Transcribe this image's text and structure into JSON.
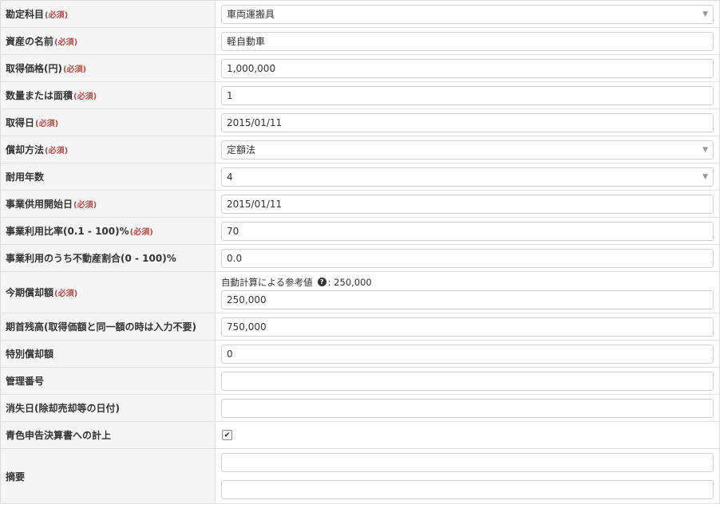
{
  "required_mark": "(必須)",
  "rows": [
    {
      "label": "勘定科目",
      "required": true,
      "type": "select",
      "value": "車両運搬具"
    },
    {
      "label": "資産の名前",
      "required": true,
      "type": "input",
      "value": "軽自動車"
    },
    {
      "label": "取得価格(円)",
      "required": true,
      "type": "input",
      "value": "1,000,000"
    },
    {
      "label": "数量または面積",
      "required": true,
      "type": "input",
      "value": "1"
    },
    {
      "label": "取得日",
      "required": true,
      "type": "input",
      "value": "2015/01/11"
    },
    {
      "label": "償却方法",
      "required": true,
      "type": "select",
      "value": "定額法"
    },
    {
      "label": "耐用年数",
      "required": false,
      "type": "select",
      "value": "4"
    },
    {
      "label": "事業供用開始日",
      "required": true,
      "type": "input",
      "value": "2015/01/11"
    },
    {
      "label": "事業利用比率(0.1 - 100)%",
      "required": true,
      "type": "input",
      "value": "70"
    },
    {
      "label": "事業利用のうち不動産割合(0 - 100)%",
      "required": false,
      "type": "input",
      "value": "0.0"
    },
    {
      "label": "今期償却額",
      "required": true,
      "type": "input",
      "value": "250,000",
      "hint_text": "自動計算による参考値",
      "hint_value": ": 250,000"
    },
    {
      "label": "期首残高(取得価額と同一額の時は入力不要)",
      "required": false,
      "type": "input",
      "value": "750,000"
    },
    {
      "label": "特別償却額",
      "required": false,
      "type": "input",
      "value": "0"
    },
    {
      "label": "管理番号",
      "required": false,
      "type": "input",
      "value": ""
    },
    {
      "label": "消失日(除却売却等の日付)",
      "required": false,
      "type": "input",
      "value": ""
    },
    {
      "label": "青色申告決算書への計上",
      "required": false,
      "type": "checkbox",
      "checked": true
    },
    {
      "label": "摘要",
      "required": false,
      "type": "double-input",
      "value1": "",
      "value2": ""
    }
  ],
  "icons": {
    "select_caret": "caret-down-icon",
    "help": "question-circle-icon",
    "check": "check-icon"
  }
}
